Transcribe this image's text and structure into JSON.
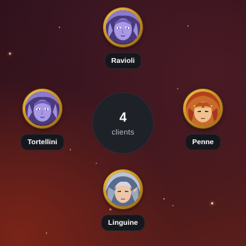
{
  "hub": {
    "count": "4",
    "label": "clients"
  },
  "clients": [
    {
      "name": "Ravioli",
      "avatar_icon": "purple-elf-avatar-icon"
    },
    {
      "name": "Tortellini",
      "avatar_icon": "purple-elf-avatar-icon"
    },
    {
      "name": "Penne",
      "avatar_icon": "red-haired-warrior-avatar-icon"
    },
    {
      "name": "Linguine",
      "avatar_icon": "silver-haired-elf-avatar-icon"
    }
  ],
  "colors": {
    "hub_background": "#1e2127",
    "pill_background": "#15171c",
    "avatar_frame_gold": "#d39a2a",
    "background_dark": "#2a0f18",
    "background_glow": "#7a2418"
  }
}
